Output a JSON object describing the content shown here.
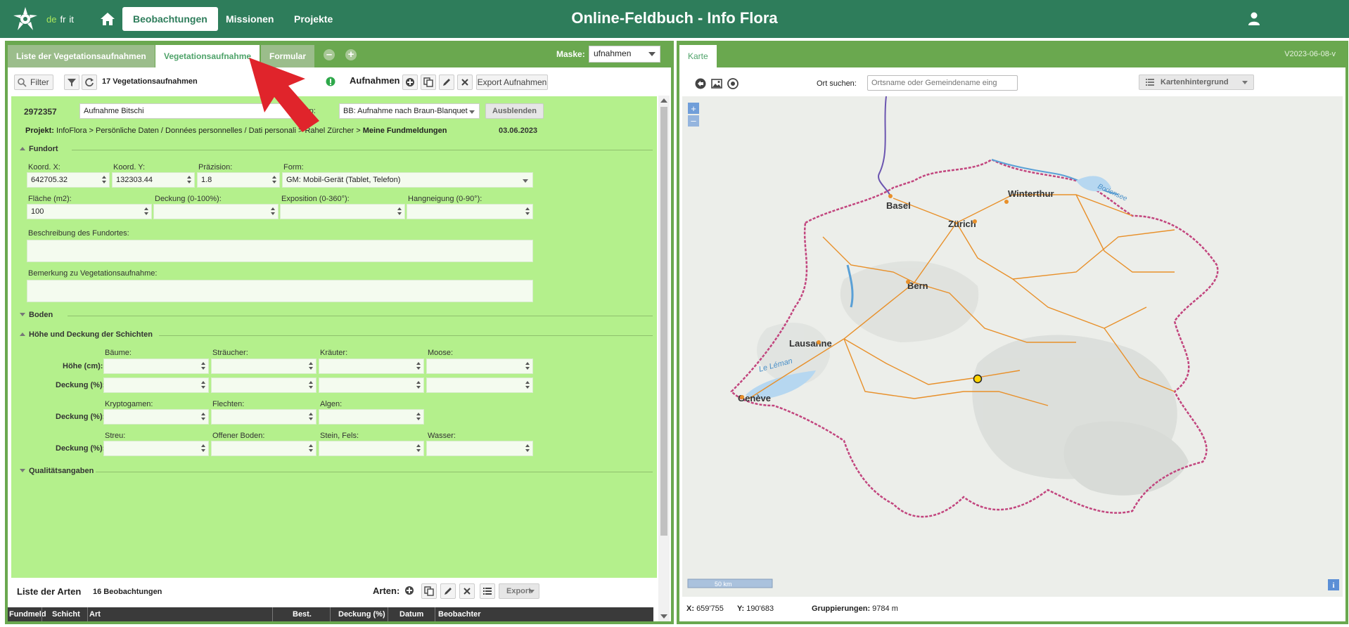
{
  "header": {
    "languages": [
      "de",
      "fr",
      "it"
    ],
    "active_language": "de",
    "nav": [
      "Beobachtungen",
      "Missionen",
      "Projekte"
    ],
    "active_nav": "Beobachtungen",
    "title": "Online-Feldbuch  -  Info Flora"
  },
  "left_panel": {
    "tabs": [
      "Liste der Vegetationsaufnahmen",
      "Vegetationsaufnahme",
      "Formular"
    ],
    "active_tab": "Vegetationsaufnahme",
    "maske_label": "Maske:",
    "maske_value": "ufnahmen",
    "toolbar": {
      "filter_label": "Filter",
      "count_text": "17 Vegetationsaufnahmen",
      "aufnahmen_label": "Aufnahmen :",
      "export_label": "Export Aufnahmen"
    },
    "record": {
      "id": "2972357",
      "name": "Aufnahme Bitschi",
      "typ_label": "Typ:",
      "typ_value": "BB: Aufnahme nach Braun-Blanquet",
      "hide_label": "Ausblenden",
      "projekt_label": "Projekt:",
      "projekt_path": "InfoFlora > Persönliche Daten / Données personnelles / Dati personali > Rahel Zürcher >",
      "projekt_bold": "Meine Fundmeldungen",
      "date": "03.06.2023"
    },
    "fundort": {
      "title": "Fundort",
      "koord_x_label": "Koord. X:",
      "koord_x": "642705.32",
      "koord_y_label": "Koord. Y:",
      "koord_y": "132303.44",
      "praezision_label": "Präzision:",
      "praezision": "1.8",
      "form_label": "Form:",
      "form": "GM: Mobil-Gerät (Tablet, Telefon)",
      "flaeche_label": "Fläche (m2):",
      "flaeche": "100",
      "deckung_label": "Deckung (0-100%):",
      "exposition_label": "Exposition (0-360°):",
      "hangneigung_label": "Hangneigung (0-90°):",
      "beschreibung_label": "Beschreibung des Fundortes:",
      "bemerkung_label": "Bemerkung zu Vegetationsaufnahme:"
    },
    "boden_title": "Boden",
    "schichten": {
      "title": "Höhe und Deckung der Schichten",
      "hoehe_label": "Höhe (cm):",
      "deckung_label": "Deckung (%):",
      "col1": [
        "Bäume:",
        "Sträucher:",
        "Kräuter:",
        "Moose:"
      ],
      "col2": [
        "Kryptogamen:",
        "Flechten:",
        "Algen:"
      ],
      "col3": [
        "Streu:",
        "Offener Boden:",
        "Stein, Fels:",
        "Wasser:"
      ]
    },
    "qualitaet_title": "Qualitätsangaben",
    "arten": {
      "title": "Liste der Arten",
      "count": "16 Beobachtungen",
      "label": "Arten:",
      "export": "Export",
      "columns": [
        "Fundmeld",
        "Schicht",
        "Art",
        "Best.",
        "Deckung (%)",
        "Datum",
        "Beobachter"
      ]
    }
  },
  "right_panel": {
    "tab": "Karte",
    "version": "V2023-06-08-v",
    "search_label": "Ort suchen:",
    "search_placeholder": "Ortsname oder Gemeindename eing",
    "background_label": "Kartenhintergrund",
    "map_labels": [
      "Basel",
      "Winterthur",
      "Zürich",
      "Bern",
      "Lausanne",
      "Genève",
      "Le Léman",
      "Bodensee"
    ],
    "scale": "50 km",
    "coords": {
      "x_label": "X:",
      "x": "659'755",
      "y_label": "Y:",
      "y": "190'683",
      "grp_label": "Gruppierungen:",
      "grp": "9784 m"
    },
    "colors": {
      "marker": "#ffd400",
      "border": "#c2457e",
      "roads": "#e8902a"
    }
  }
}
